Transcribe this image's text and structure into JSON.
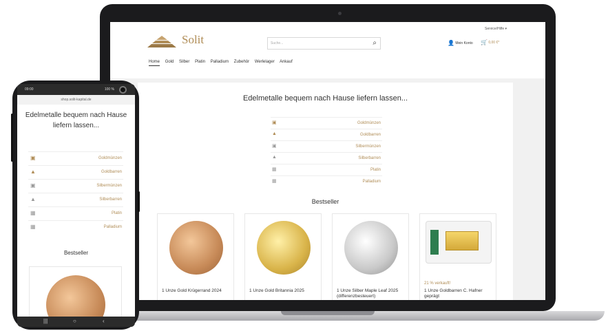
{
  "desktop": {
    "service_menu": "Service/Hilfe ▾",
    "logo_text": "Solit",
    "search_placeholder": "Suche...",
    "account_label": "Mein Konto",
    "cart_total": "0,00 €*",
    "nav": [
      "Home",
      "Gold",
      "Silber",
      "Platin",
      "Palladium",
      "Zubehör",
      "Werlelager",
      "Ankauf"
    ],
    "headline": "Edelmetalle bequem nach Hause liefern lassen...",
    "categories": [
      {
        "label": "Goldmünzen",
        "icon": "gold-coins-icon"
      },
      {
        "label": "Goldbarren",
        "icon": "gold-bars-icon"
      },
      {
        "label": "Silbermünzen",
        "icon": "silver-coins-icon"
      },
      {
        "label": "Silberbarren",
        "icon": "silver-bars-icon"
      },
      {
        "label": "Platin",
        "icon": "platinum-icon"
      },
      {
        "label": "Palladium",
        "icon": "palladium-icon"
      }
    ],
    "bestseller_title": "Bestseller",
    "products": [
      {
        "name": "1 Unze Gold Krügerrand 2024",
        "badge": ""
      },
      {
        "name": "1 Unze Gold Britannia 2025",
        "badge": ""
      },
      {
        "name": "1 Unze Silber Maple Leaf 2025 (differenzbesteuert)",
        "badge": ""
      },
      {
        "name": "1 Unze Goldbarren C. Hafner geprägt",
        "badge": "21 % verkauft!"
      }
    ]
  },
  "mobile": {
    "time": "09:00",
    "battery": "100 %",
    "url": "shop.solit-kapital.de",
    "headline": "Edelmetalle bequem nach Hause liefern lassen...",
    "categories": [
      "Goldmünzen",
      "Goldbarren",
      "Silbermünzen",
      "Silberbarren",
      "Platin",
      "Palladium"
    ],
    "bestseller_title": "Bestseller"
  },
  "colors": {
    "accent": "#b08d57",
    "frame": "#1b1b1d"
  }
}
